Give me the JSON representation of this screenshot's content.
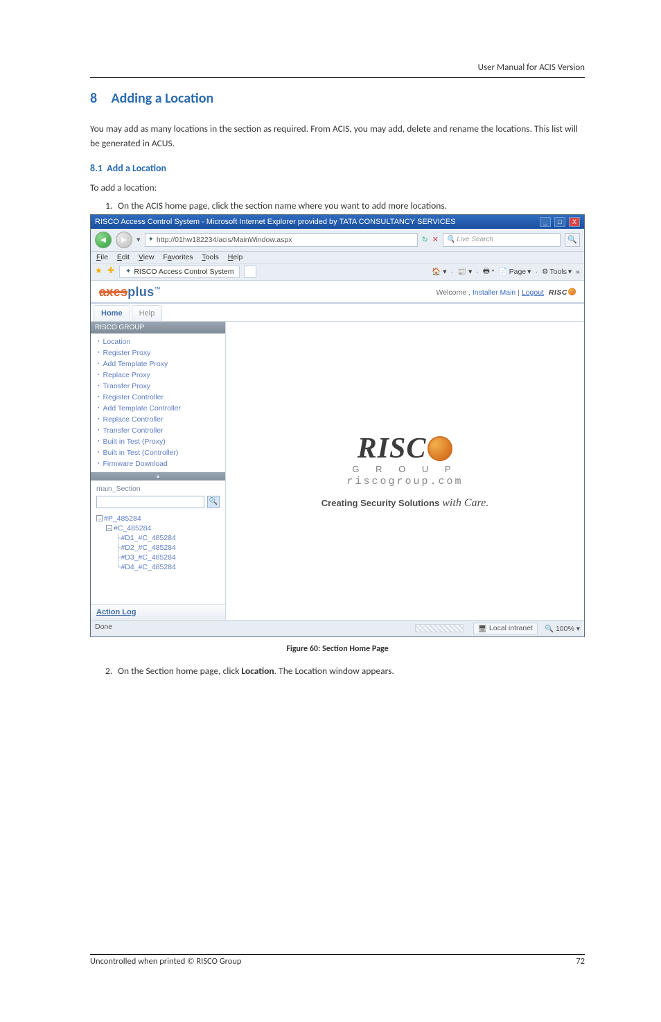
{
  "header": {
    "right": "User Manual for ACIS Version"
  },
  "section": {
    "num": "8",
    "title": "Adding a Location"
  },
  "intro": "You may add as many locations in the section as required. From ACIS, you may add, delete and rename the locations. This list will be generated in ACUS.",
  "sub": {
    "num": "8.1",
    "title": "Add a Location"
  },
  "lead": "To add a location:",
  "steps": {
    "s1": "On the ACIS home page, click the section name where you want to add more locations.",
    "s2_a": "On the Section home page, click ",
    "s2_b": "Location",
    "s2_c": ". The Location window appears."
  },
  "figure": "Figure 60: Section Home Page",
  "footer": {
    "left": "Uncontrolled when printed © RISCO Group",
    "right": "72"
  },
  "ie": {
    "title": "RISCO Access Control System - Microsoft Internet Explorer provided by TATA CONSULTANCY SERVICES",
    "url": "http://01hw182234/acis/MainWindow.aspx",
    "search_placeholder": "Live Search",
    "tab_label": "RISCO Access Control System",
    "menu": {
      "file": "File",
      "edit": "Edit",
      "view": "View",
      "fav": "Favorites",
      "tools": "Tools",
      "help": "Help"
    },
    "toolbar": {
      "page": "Page",
      "tools": "Tools"
    },
    "status_done": "Done",
    "status_intranet": "Local intranet",
    "zoom": "100%"
  },
  "app": {
    "welcome_prefix": "Welcome ,  ",
    "welcome_user": "Installer Main",
    "welcome_sep": "  |  ",
    "logout": "Logout",
    "brand_risco": "RISC",
    "tabs": {
      "home": "Home",
      "help": "Help"
    },
    "group": "RISCO GROUP",
    "nav": {
      "location": "Location",
      "reg_proxy": "Register Proxy",
      "add_tmpl_proxy": "Add Template Proxy",
      "replace_proxy": "Replace Proxy",
      "transfer_proxy": "Transfer Proxy",
      "reg_ctrl": "Register Controller",
      "add_tmpl_ctrl": "Add Template Controller",
      "replace_ctrl": "Replace Controller",
      "transfer_ctrl": "Transfer Controller",
      "bit_proxy": "Built in Test (Proxy)",
      "bit_ctrl": "Built in Test (Controller)",
      "fw": "Firmware Download"
    },
    "tree_label": "main_Section",
    "tree": {
      "p": "#P_485284",
      "c": "#C_485284",
      "d1": "#D1_#C_485284",
      "d2": "#D2_#C_485284",
      "d3": "#D3_#C_485284",
      "d4": "#D4_#C_485284"
    },
    "action_log": "Action Log"
  },
  "risco": {
    "big_text": "RISC",
    "group_letters": "G R O U P",
    "domain": "riscogroup.com",
    "tagline_a": "Creating Security Solutions",
    "tagline_b": "with Care."
  }
}
